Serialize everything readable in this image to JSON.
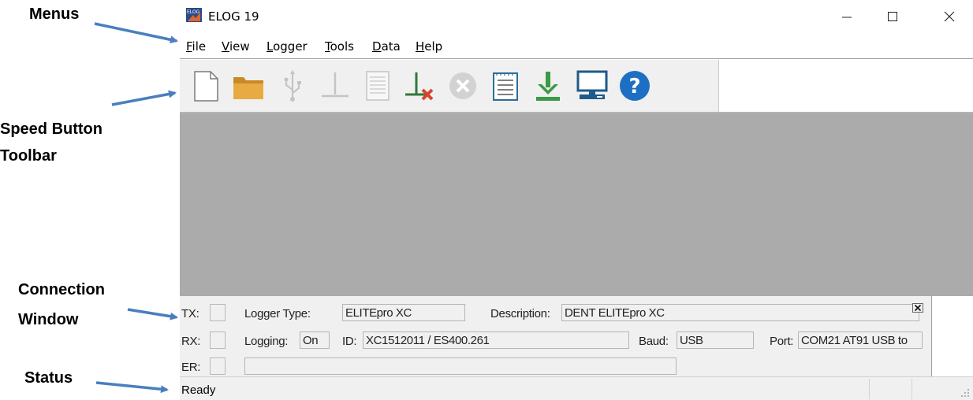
{
  "annotations": {
    "menus": "Menus",
    "speed_toolbar_line1": "Speed Button",
    "speed_toolbar_line2": "Toolbar",
    "connection_line1": "Connection",
    "connection_line2": "Window",
    "status": "Status",
    "arrow_color": "#4a7ebf"
  },
  "window": {
    "title": "ELOG 19",
    "minimize_glyph": "—",
    "maximize_glyph": "☐",
    "close_glyph": "✕"
  },
  "menu": [
    {
      "mnemonic": "F",
      "rest": "ile"
    },
    {
      "mnemonic": "V",
      "rest": "iew"
    },
    {
      "mnemonic": "L",
      "rest": "ogger"
    },
    {
      "mnemonic": "T",
      "rest": "ools"
    },
    {
      "mnemonic": "D",
      "rest": "ata"
    },
    {
      "mnemonic": "H",
      "rest": "elp"
    }
  ],
  "toolbar": {
    "buttons": [
      {
        "icon": "new-document-icon",
        "enabled": true
      },
      {
        "icon": "open-folder-icon",
        "enabled": true
      },
      {
        "icon": "usb-connect-icon",
        "enabled": false
      },
      {
        "icon": "disconnect-icon",
        "enabled": false
      },
      {
        "icon": "log-sheet-icon",
        "enabled": false
      },
      {
        "icon": "stop-logging-icon",
        "enabled": true
      },
      {
        "icon": "cancel-icon",
        "enabled": false
      },
      {
        "icon": "notepad-icon",
        "enabled": true
      },
      {
        "icon": "download-icon",
        "enabled": true
      },
      {
        "icon": "computer-icon",
        "enabled": true
      },
      {
        "icon": "help-icon",
        "enabled": true
      }
    ]
  },
  "colors": {
    "workspace": "#ababab",
    "folder": "#e0a33a",
    "download_green": "#3a9a46",
    "help_blue": "#1d6fc4",
    "stop_red": "#d8442c"
  },
  "connection": {
    "tx_label": "TX:",
    "rx_label": "RX:",
    "er_label": "ER:",
    "logger_type_label": "Logger Type:",
    "logger_type_value": "ELITEpro XC",
    "description_label": "Description:",
    "description_value": "DENT ELITEpro XC",
    "logging_label": "Logging:",
    "logging_value": "On",
    "id_label": "ID:",
    "id_value": "XC1512011 / ES400.261",
    "baud_label": "Baud:",
    "baud_value": "USB",
    "port_label": "Port:",
    "port_value": "COM21 AT91 USB to",
    "er_value": ""
  },
  "status": {
    "text": "Ready"
  }
}
